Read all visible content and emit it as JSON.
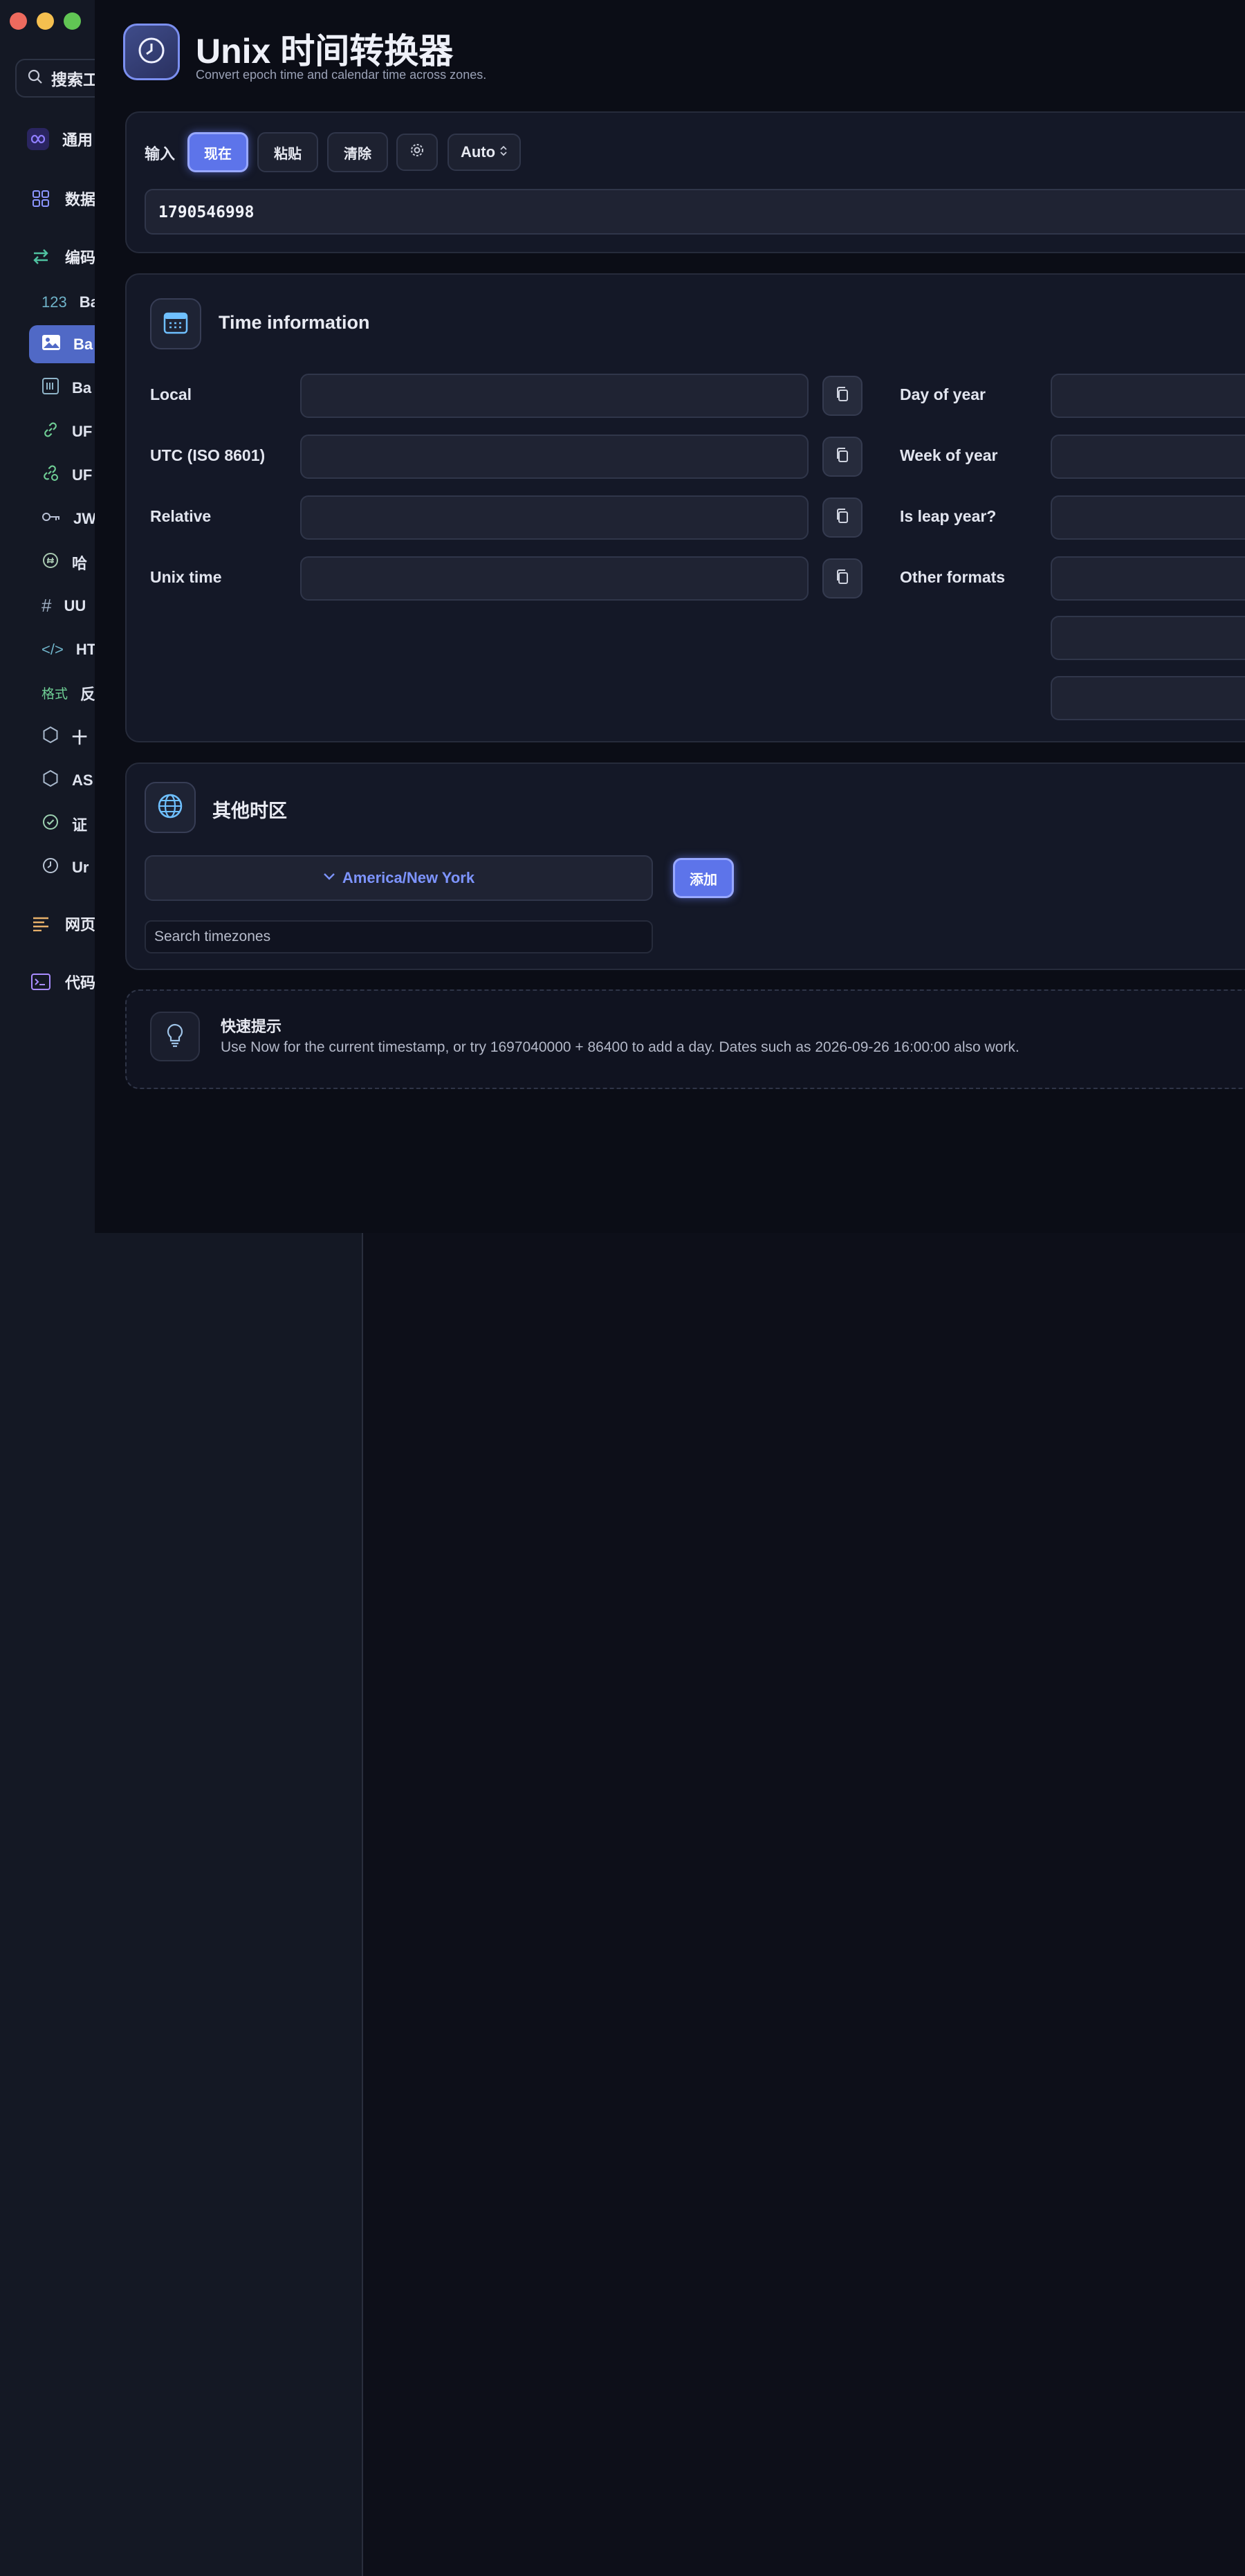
{
  "sidebar": {
    "search_label": "搜索工",
    "groups": [
      {
        "label": "通用",
        "icon": "infinity-icon",
        "color": "#7b6cf0"
      },
      {
        "label": "数据",
        "icon": "grid-icon",
        "color": "#8b95ff"
      },
      {
        "label": "编码",
        "icon": "arrows-icon",
        "color": "#4fc2a0"
      },
      {
        "label": "网页",
        "icon": "text-lines-icon",
        "color": "#e7b06a"
      },
      {
        "label": "代码",
        "icon": "terminal-icon",
        "color": "#a98cff"
      }
    ],
    "items": [
      {
        "prefix": "123",
        "label": "Ba"
      },
      {
        "prefix": "",
        "label": "Ba"
      },
      {
        "prefix": "",
        "label": "Ba"
      },
      {
        "prefix": "",
        "label": "UF"
      },
      {
        "prefix": "",
        "label": "UF"
      },
      {
        "prefix": "",
        "label": "JW"
      },
      {
        "prefix": "",
        "label": "哈"
      },
      {
        "prefix": "#",
        "label": "UU"
      },
      {
        "prefix": "</>",
        "label": "HT"
      },
      {
        "prefix": "格式",
        "label": "反"
      },
      {
        "prefix": "",
        "label": "十"
      },
      {
        "prefix": "",
        "label": "AS"
      },
      {
        "prefix": "",
        "label": "证"
      },
      {
        "prefix": "",
        "label": "Ur"
      }
    ]
  },
  "header": {
    "title": "Unix 时间转换器",
    "subtitle": "Convert epoch time and calendar time across zones."
  },
  "input": {
    "label": "输入",
    "now_button": "现在",
    "paste_button": "粘贴",
    "clear_button": "清除",
    "mode": "Auto",
    "value": "1790546998"
  },
  "time_info": {
    "title": "Time information",
    "left_labels": [
      "Local",
      "UTC (ISO 8601)",
      "Relative",
      "Unix time"
    ],
    "right_labels": [
      "Day of year",
      "Week of year",
      "Is leap year?",
      "Other formats"
    ]
  },
  "timezones": {
    "title": "其他时区",
    "selected": "America/New York",
    "add_button": "添加",
    "search_placeholder": "Search timezones"
  },
  "tip": {
    "title": "快速提示",
    "text": "Use Now for the current timestamp, or try 1697040000 + 86400 to add a day. Dates such as 2026-09-26 16:00:00 also work."
  }
}
